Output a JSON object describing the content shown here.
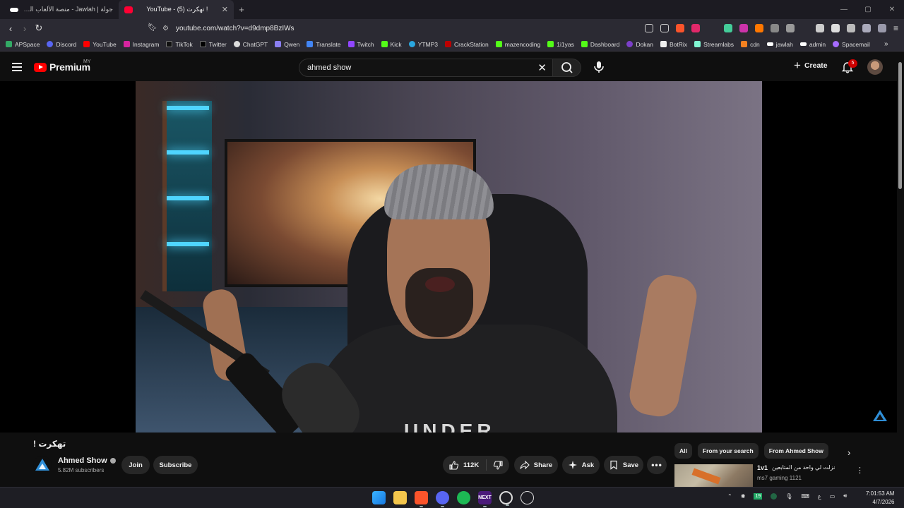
{
  "browser": {
    "tabs": [
      {
        "title": "جولة | Jawlah - منصة الألعاب التفاعلية",
        "active": false
      },
      {
        "title": "YouTube - (5) تهكرت !",
        "active": true
      }
    ],
    "url": "youtube.com/watch?v=d9dmp8BzIWs",
    "bookmarks": [
      "APSpace",
      "Discord",
      "YouTube",
      "Instagram",
      "TikTok",
      "Twitter",
      "ChatGPT",
      "Qwen",
      "Translate",
      "Twitch",
      "Kick",
      "YTMP3",
      "CrackStation",
      "mazencoding",
      "1i1yas",
      "Dashboard",
      "Dokan",
      "BotRix",
      "Streamlabs",
      "cdn",
      "jawlah",
      "admin",
      "Spacemail"
    ],
    "extension_badges": {
      "brave": "",
      "alerts": "1",
      "ext3": "5"
    }
  },
  "youtube": {
    "logo_word": "Premium",
    "region": "MY",
    "search_value": "ahmed show",
    "create_label": "Create",
    "notifications_count": "5"
  },
  "video": {
    "title": "تهكرت !",
    "shirt_text": "UNDER"
  },
  "channel": {
    "name": "Ahmed Show",
    "subscribers": "5.82M subscribers",
    "join_label": "Join",
    "subscribe_label": "Subscribe"
  },
  "actions": {
    "likes": "112K",
    "share_label": "Share",
    "ask_label": "Ask",
    "save_label": "Save"
  },
  "chips": [
    "All",
    "From your search",
    "From Ahmed Show"
  ],
  "recommendation": {
    "title_tag": "1v1",
    "title_arabic": "نزلت لي واحد من المتابعين",
    "channel": "ms7 gaming 1121"
  },
  "taskbar": {
    "tray_lang": "ع",
    "tray_badge": "19",
    "time": "7:01:53 AM",
    "date": "4/7/2026"
  },
  "colors": {
    "brand_red": "#ff0000",
    "bg": "#0f0f0f",
    "pill": "#272727"
  }
}
